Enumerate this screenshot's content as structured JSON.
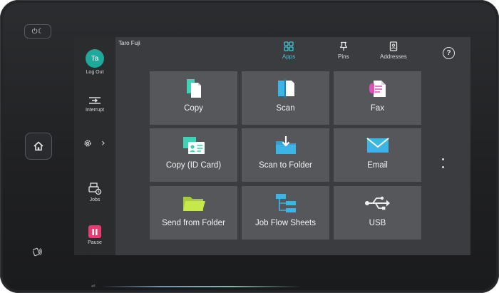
{
  "hardware": {
    "power_glyph": "⏻☾",
    "home_icon": "home-icon",
    "nfc_icon": "nfc-icon",
    "usb_glyph": "⇌"
  },
  "header": {
    "user_name": "Taro Fuji",
    "tabs": [
      {
        "label": "Apps",
        "icon": "apps-grid-icon",
        "active": true
      },
      {
        "label": "Pins",
        "icon": "pin-icon",
        "active": false
      },
      {
        "label": "Addresses",
        "icon": "address-book-icon",
        "active": false
      }
    ],
    "help_glyph": "?"
  },
  "sidebar": {
    "avatar_initials": "Ta",
    "logout_label": "Log Out",
    "interrupt_label": "Interrupt",
    "settings_chevron": "›",
    "jobs_label": "Jobs",
    "pause_label": "Pause"
  },
  "apps": [
    {
      "label": "Copy",
      "icon": "copy-icon"
    },
    {
      "label": "Scan",
      "icon": "scan-icon"
    },
    {
      "label": "Fax",
      "icon": "fax-icon"
    },
    {
      "label": "Copy (ID Card)",
      "icon": "id-card-copy-icon"
    },
    {
      "label": "Scan to Folder",
      "icon": "scan-to-folder-icon"
    },
    {
      "label": "Email",
      "icon": "email-icon"
    },
    {
      "label": "Send from Folder",
      "icon": "send-from-folder-icon"
    },
    {
      "label": "Job Flow Sheets",
      "icon": "job-flow-icon"
    },
    {
      "label": "USB",
      "icon": "usb-icon"
    }
  ],
  "colors": {
    "accent": "#40c6d6",
    "avatar": "#1fa99a",
    "pause": "#e33d73",
    "tile": "#56575a",
    "screen": "#3b3c3f",
    "sidebar": "#2b2c2e"
  }
}
